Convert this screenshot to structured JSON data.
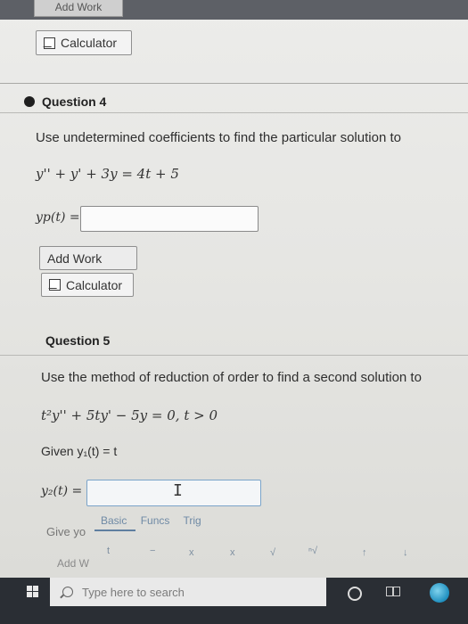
{
  "top": {
    "cut_button": "Add Work",
    "calculator": "Calculator"
  },
  "q4": {
    "title": "Question 4",
    "prompt": "Use undetermined coefficients to find the particular solution to",
    "equation": "y'' + y' + 3y = 4t + 5",
    "answer_label": "yp(t) =",
    "add_work": "Add Work",
    "calculator": "Calculator"
  },
  "q5": {
    "title": "Question 5",
    "prompt": "Use the method of reduction of order to find a second solution to",
    "equation": "t²y'' + 5ty' − 5y = 0,  t > 0",
    "given": "Given y₁(t) = t",
    "answer_label": "y₂(t) =",
    "give_your": "Give yo",
    "add_work": "Add W",
    "tabs": [
      "Basic",
      "Funcs",
      "Trig"
    ],
    "symbols": [
      "t",
      "−",
      "x",
      "x",
      "√",
      "ⁿ√",
      "↑",
      "↓"
    ]
  },
  "taskbar": {
    "search_placeholder": "Type here to search"
  }
}
